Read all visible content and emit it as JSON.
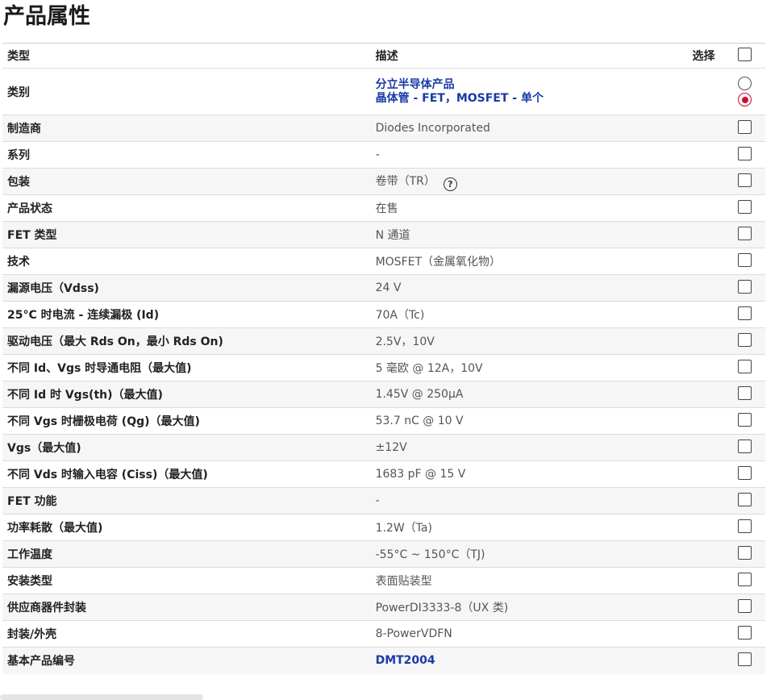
{
  "page": {
    "title": "产品属性"
  },
  "table": {
    "headers": {
      "type": "类型",
      "description": "描述",
      "select": "选择"
    },
    "category": {
      "name": "类别",
      "options": [
        "分立半导体产品",
        "晶体管 - FET，MOSFET - 单个"
      ],
      "selected_index": 1
    },
    "rows": [
      {
        "name": "制造商",
        "value": "Diodes Incorporated"
      },
      {
        "name": "系列",
        "value": "-"
      },
      {
        "name": "包装",
        "value": "卷带（TR）",
        "help_icon": "question-circle-icon"
      },
      {
        "name": "产品状态",
        "value": "在售"
      },
      {
        "name": "FET 类型",
        "value": "N 通道"
      },
      {
        "name": "技术",
        "value": "MOSFET（金属氧化物）"
      },
      {
        "name": "漏源电压（Vdss)",
        "value": "24 V"
      },
      {
        "name": "25°C 时电流 - 连续漏极 (Id)",
        "value": "70A（Tc)"
      },
      {
        "name": "驱动电压（最大 Rds On，最小 Rds On)",
        "value": "2.5V，10V"
      },
      {
        "name": "不同 Id、Vgs 时导通电阻（最大值)",
        "value": "5 毫欧 @ 12A，10V"
      },
      {
        "name": "不同 Id 时 Vgs(th)（最大值)",
        "value": "1.45V @ 250µA"
      },
      {
        "name": "不同 Vgs 时栅极电荷 (Qg)（最大值)",
        "value": "53.7 nC @ 10 V"
      },
      {
        "name": "Vgs（最大值)",
        "value": "±12V"
      },
      {
        "name": "不同 Vds 时输入电容 (Ciss)（最大值)",
        "value": "1683 pF @ 15 V"
      },
      {
        "name": "FET 功能",
        "value": "-"
      },
      {
        "name": "功率耗散（最大值)",
        "value": "1.2W（Ta)"
      },
      {
        "name": "工作温度",
        "value": "-55°C ~ 150°C（TJ)"
      },
      {
        "name": "安装类型",
        "value": "表面贴装型"
      },
      {
        "name": "供应商器件封装",
        "value": "PowerDI3333-8（UX 类)"
      },
      {
        "name": "封装/外壳",
        "value": "8-PowerVDFN"
      },
      {
        "name": "基本产品编号",
        "value": "DMT2004",
        "link": true
      }
    ]
  },
  "colors": {
    "link": "#1a3aa8",
    "radio_selected": "#c8102e",
    "row_alt": "#f6f6f6"
  }
}
